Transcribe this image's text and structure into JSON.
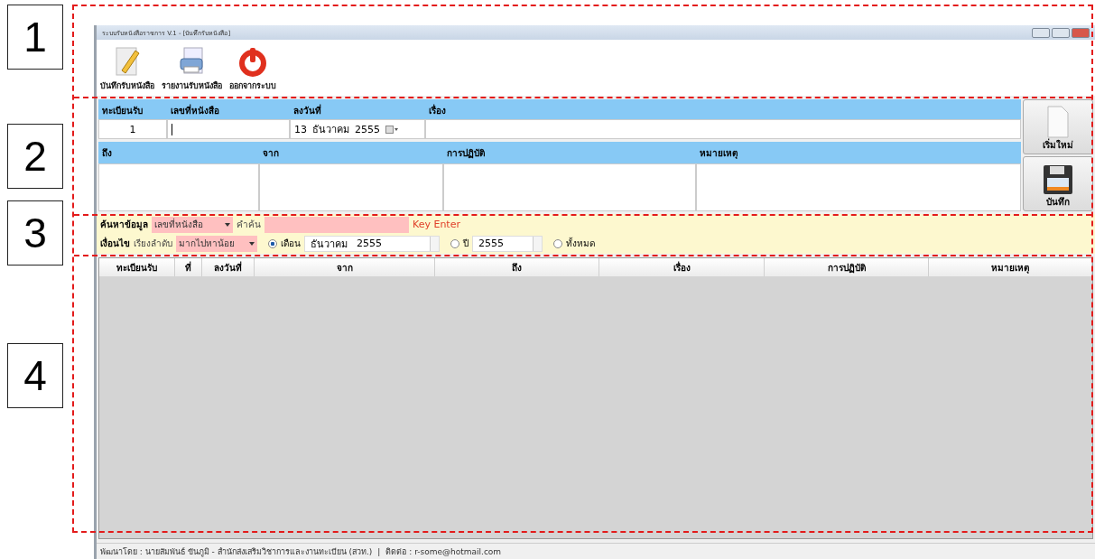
{
  "annotations": [
    {
      "label": "1"
    },
    {
      "label": "2"
    },
    {
      "label": "3"
    },
    {
      "label": "4"
    }
  ],
  "window": {
    "title": "ระบบรับหนังสือราชการ V.1 - [บันทึกรับหนังสือ]"
  },
  "toolbar": [
    {
      "label": "บันทึกรับหนังสือ",
      "kind": "pencil"
    },
    {
      "label": "รายงานรับหนังสือ",
      "kind": "printer"
    },
    {
      "label": "ออกจากระบบ",
      "kind": "power"
    }
  ],
  "form": {
    "row1": [
      {
        "label": "ทะเบียนรับ",
        "value": "1",
        "kind": "number"
      },
      {
        "label": "เลขที่หนังสือ",
        "kind": "input"
      },
      {
        "label": "ลงวันที่",
        "kind": "date",
        "day": "13",
        "month": "ธันวาคม",
        "year": "2555"
      },
      {
        "label": "เรื่อง",
        "kind": "input"
      }
    ],
    "row2": [
      {
        "label": "ถึง"
      },
      {
        "label": "จาก"
      },
      {
        "label": "การปฏิบัติ"
      },
      {
        "label": "หมายเหตุ"
      }
    ]
  },
  "side_buttons": [
    {
      "label": "เริ่มใหม่",
      "kind": "new"
    },
    {
      "label": "บันทึก",
      "kind": "save"
    }
  ],
  "search": {
    "label": "ค้นหาข้อมูล",
    "field": "เลขที่หนังสือ",
    "keyword_label": "คำค้น",
    "hint": "Key Enter",
    "condition_label": "เงื่อนไข",
    "sort_label": "เรียงลำดับ",
    "sort": "มากไปหาน้อย",
    "options": [
      {
        "label": "เดือน",
        "selected": true,
        "month": "ธันวาคม",
        "year": "2555"
      },
      {
        "label": "ปี",
        "selected": false,
        "year": "2555"
      },
      {
        "label": "ทั้งหมด",
        "selected": false
      }
    ]
  },
  "table": {
    "columns": [
      "ทะเบียนรับ",
      "ที่",
      "ลงวันที่",
      "จาก",
      "ถึง",
      "เรื่อง",
      "การปฏิบัติ",
      "หมายเหตุ"
    ]
  },
  "status_bar": {
    "developer": "พัฒนาโดย : นายสัมพันธ์ ขันภูมิ - สำนักส่งเสริมวิชาการและงานทะเบียน (สวท.)",
    "separator": "|",
    "contact": "ติดต่อ : r-some@hotmail.com"
  }
}
